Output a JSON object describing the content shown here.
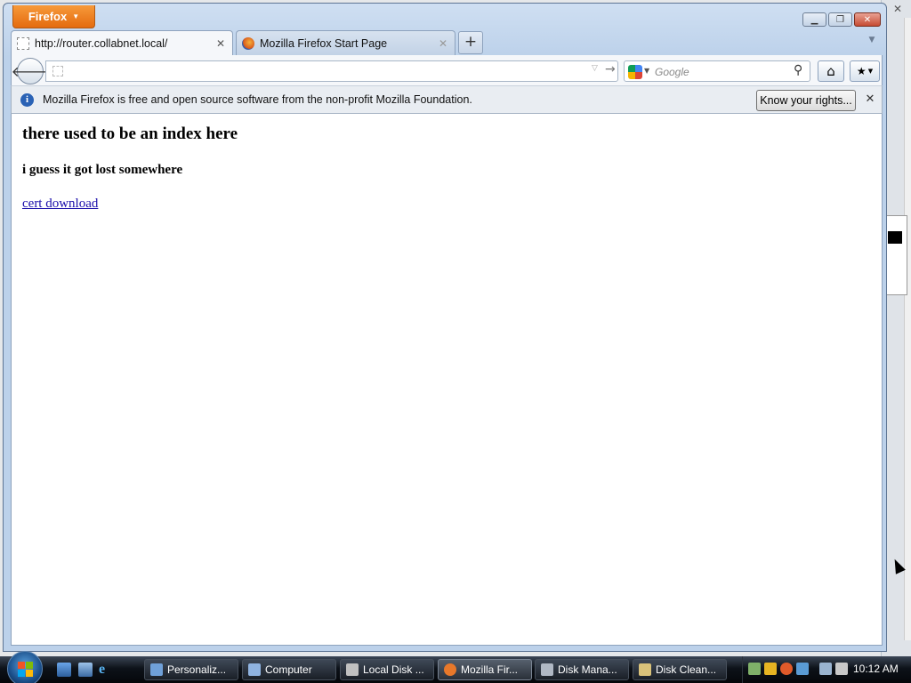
{
  "browser": {
    "menu_button_label": "Firefox",
    "tabs": [
      {
        "title": "http://router.collabnet.local/",
        "active": true,
        "icon": "blank-page-icon"
      },
      {
        "title": "Mozilla Firefox Start Page",
        "active": false,
        "icon": "firefox-icon"
      }
    ],
    "url_value": "",
    "search": {
      "engine_icon": "google-icon",
      "placeholder": "Google"
    },
    "notification": {
      "message": "Mozilla Firefox is free and open source software from the non-profit Mozilla Foundation.",
      "button_label": "Know your rights..."
    }
  },
  "page": {
    "heading": "there used to be an index here",
    "subheading": "i guess it got lost somewhere",
    "link_text": "cert download"
  },
  "taskbar": {
    "tasks": [
      {
        "label": "Personaliz...",
        "icon": "personalize-icon",
        "color": "#6fa0d8"
      },
      {
        "label": "Computer",
        "icon": "computer-icon",
        "color": "#8fb3e0"
      },
      {
        "label": "Local Disk ...",
        "icon": "disk-icon",
        "color": "#c0c0c0"
      },
      {
        "label": "Mozilla Fir...",
        "icon": "firefox-icon",
        "color": "#e8782a",
        "active": true
      },
      {
        "label": "Disk Mana...",
        "icon": "disk-management-icon",
        "color": "#b0b8c4"
      },
      {
        "label": "Disk Clean...",
        "icon": "disk-cleanup-icon",
        "color": "#d9c27a"
      }
    ],
    "clock": "10:12 AM"
  },
  "colors": {
    "menu_button": "#e46b0f",
    "link": "#1a0dab",
    "info_icon": "#2a62b5"
  }
}
